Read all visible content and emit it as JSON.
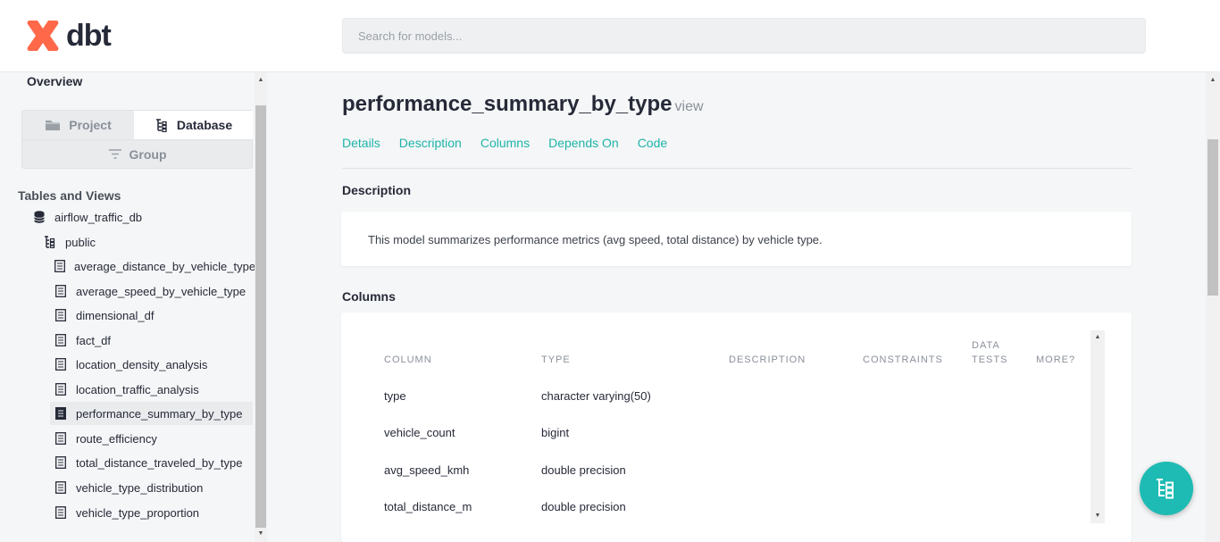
{
  "app": {
    "logo_text": "dbt",
    "brand_color": "#ff694a",
    "accent_color": "#1eb3a9"
  },
  "search": {
    "placeholder": "Search for models..."
  },
  "sidebar": {
    "overview": "Overview",
    "tabs": {
      "project": "Project",
      "database": "Database",
      "group": "Group"
    },
    "section_title": "Tables and Views",
    "database": "airflow_traffic_db",
    "schema": "public",
    "items": [
      "average_distance_by_vehicle_type",
      "average_speed_by_vehicle_type",
      "dimensional_df",
      "fact_df",
      "location_density_analysis",
      "location_traffic_analysis",
      "performance_summary_by_type",
      "route_efficiency",
      "total_distance_traveled_by_type",
      "vehicle_type_distribution",
      "vehicle_type_proportion"
    ],
    "active_item": "performance_summary_by_type"
  },
  "main": {
    "title": "performance_summary_by_type",
    "subtitle": "view",
    "nav": [
      "Details",
      "Description",
      "Columns",
      "Depends On",
      "Code"
    ],
    "description_title": "Description",
    "description_text": "This model summarizes performance metrics (avg speed, total distance) by vehicle type.",
    "columns_title": "Columns",
    "columns_headers": {
      "column": "COLUMN",
      "type": "TYPE",
      "description": "DESCRIPTION",
      "constraints": "CONSTRAINTS",
      "data_tests_1": "DATA",
      "data_tests_2": "TESTS",
      "more": "MORE?"
    },
    "columns_rows": [
      {
        "name": "type",
        "type": "character varying(50)"
      },
      {
        "name": "vehicle_count",
        "type": "bigint"
      },
      {
        "name": "avg_speed_kmh",
        "type": "double precision"
      },
      {
        "name": "total_distance_m",
        "type": "double precision"
      }
    ]
  },
  "fab": {
    "icon": "lineage-icon"
  }
}
